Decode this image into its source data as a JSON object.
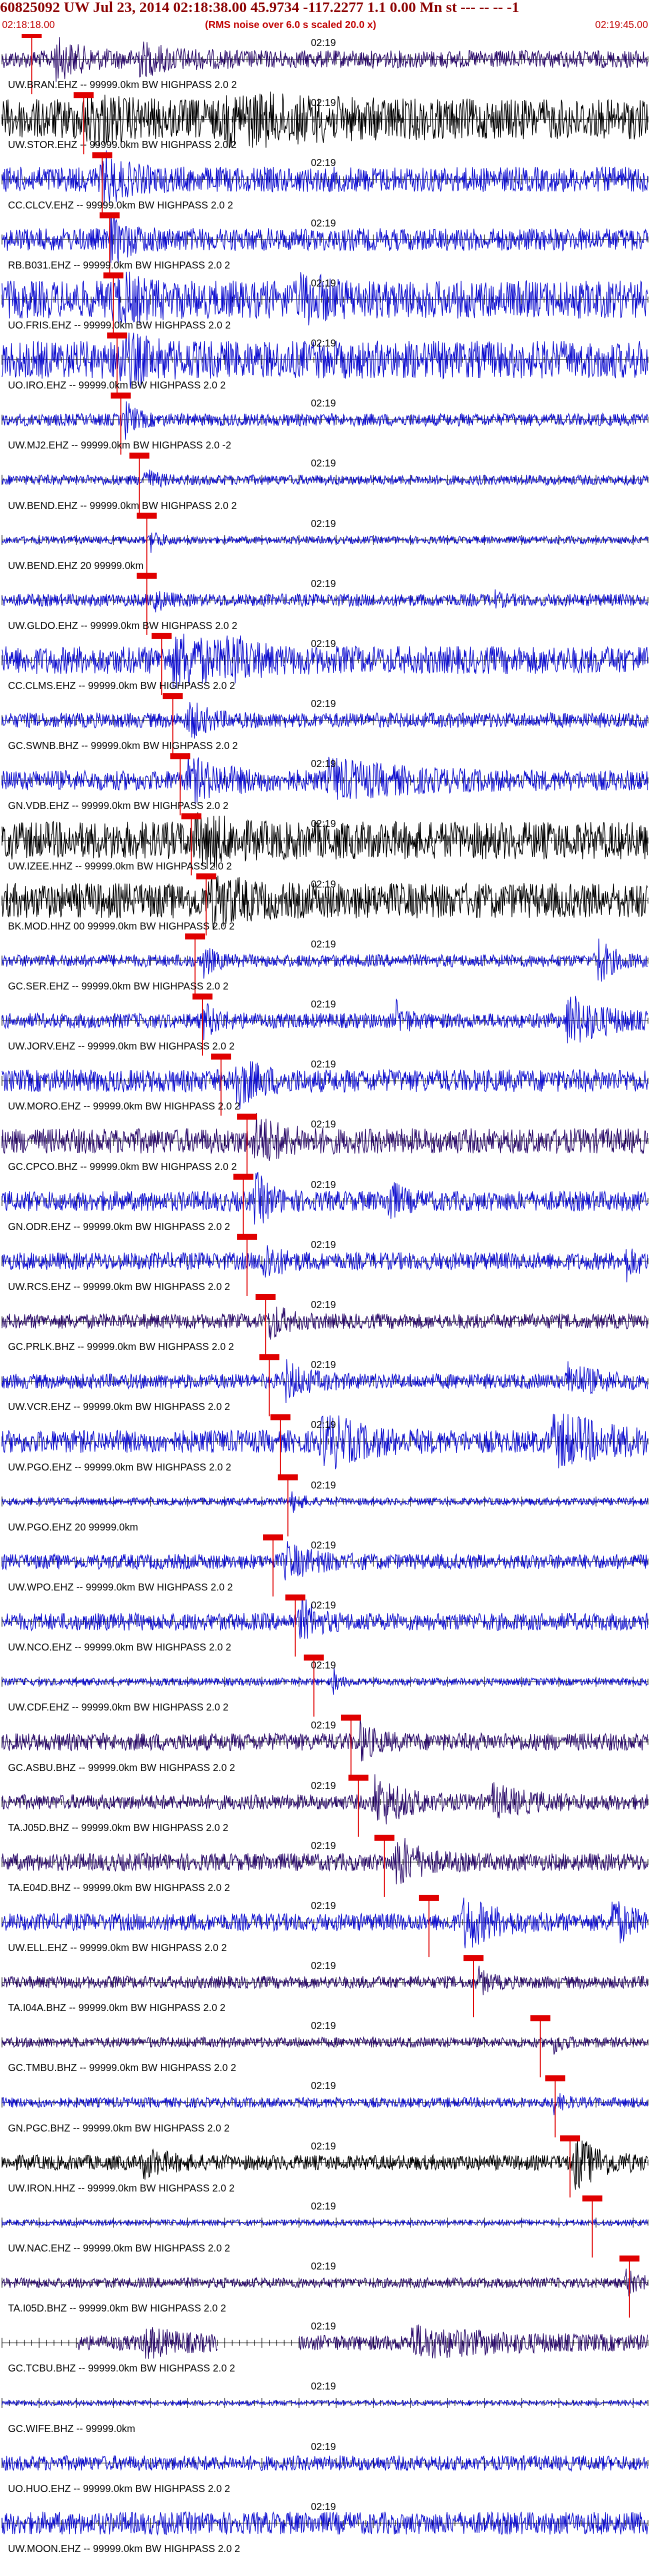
{
  "header": {
    "title": "60825092 UW Jul 23, 2014 02:18:38.00   45.9734 -117.2277  1.1 0.00 Mn st --- -- --  -1",
    "subtitle": "(RMS noise over 6.0 s scaled 20.0 x)",
    "start_time": "02:18:18.00",
    "end_time": "02:19:45.00"
  },
  "colors": {
    "blue_trace": "#1010d0",
    "black_trace": "#000000",
    "purple_trace": "#2a0a6a",
    "pick": "#e00000",
    "tick": "#000000",
    "background": "#ffffff"
  },
  "chart_data": {
    "type": "line",
    "title": "60825092 UW Jul 23, 2014 02:18:38.00   45.9734 -117.2277  1.1 0.00 Mn st --- -- --  -1",
    "subtitle": "(RMS noise over 6.0 s scaled 20.0 x)",
    "x_range": [
      "02:18:18.00",
      "02:19:45.00"
    ],
    "x_start_seconds": 0,
    "x_end_seconds": 87,
    "time_tick_label": "02:19",
    "time_tick_seconds": 42,
    "grid": false,
    "legend": "none",
    "traces": [
      {
        "label": "UW.BRAN.EHZ -- 99999.0km BW HIGHPASS 2.0 2",
        "color": "purple",
        "pick": 4.0,
        "noise": 0.35,
        "events": [
          [
            7,
            7,
            0.7
          ],
          [
            18,
            10,
            0.5
          ]
        ]
      },
      {
        "label": "UW.STOR.EHZ -- 99999.0km BW HIGHPASS 2.0 2",
        "color": "black",
        "pick": 11.0,
        "noise": 0.8,
        "events": [
          [
            11,
            6,
            1.0
          ],
          [
            30,
            20,
            0.6
          ]
        ]
      },
      {
        "label": "CC.CLCV.EHZ -- 99999.0km BW HIGHPASS 2.0 2",
        "color": "blue",
        "pick": 13.5,
        "noise": 0.5,
        "events": [
          [
            13.5,
            6,
            0.8
          ]
        ]
      },
      {
        "label": "RB.B031.EHZ -- 99999.0km BW HIGHPASS 2.0 2",
        "color": "blue",
        "pick": 14.5,
        "noise": 0.45,
        "events": [
          [
            14.5,
            5,
            0.8
          ]
        ]
      },
      {
        "label": "UO.FRIS.EHZ -- 99999.0km BW HIGHPASS 2.0 2",
        "color": "blue",
        "pick": 15.0,
        "noise": 0.75,
        "events": [
          [
            15,
            5,
            1.0
          ],
          [
            40,
            6,
            0.7
          ]
        ]
      },
      {
        "label": "UO.IRO.EHZ -- 99999.0km BW HIGHPASS 2.0 2",
        "color": "blue",
        "pick": 15.5,
        "noise": 0.75,
        "events": [
          [
            15.5,
            6,
            0.9
          ]
        ]
      },
      {
        "label": "UW.MJ2.EHZ -- 99999.0km BW HIGHPASS 2.0 -2",
        "color": "blue",
        "pick": 16.0,
        "noise": 0.25,
        "events": [
          [
            16.5,
            3,
            0.7
          ]
        ]
      },
      {
        "label": "UW.BEND.EHZ -- 99999.0km BW HIGHPASS 2.0 2",
        "color": "blue",
        "pick": 18.5,
        "noise": 0.2,
        "events": [
          [
            19,
            3,
            0.5
          ]
        ]
      },
      {
        "label": "UW.BEND.EHZ 20 99999.0km",
        "color": "blue",
        "pick": 19.5,
        "noise": 0.15,
        "events": [
          [
            20,
            3,
            0.4
          ]
        ]
      },
      {
        "label": "UW.GLDO.EHZ -- 99999.0km BW HIGHPASS 2.0 2",
        "color": "blue",
        "pick": 19.5,
        "noise": 0.25,
        "events": [
          [
            20,
            3,
            0.5
          ],
          [
            66,
            2,
            0.3
          ]
        ]
      },
      {
        "label": "CC.CLMS.EHZ -- 99999.0km BW HIGHPASS 2.0 2",
        "color": "blue",
        "pick": 21.5,
        "noise": 0.55,
        "events": [
          [
            23,
            10,
            1.0
          ],
          [
            30,
            5,
            0.8
          ]
        ]
      },
      {
        "label": "GC.SWNB.BHZ -- 99999.0km BW HIGHPASS 2.0 2",
        "color": "blue",
        "pick": 23.0,
        "noise": 0.3,
        "events": [
          [
            25,
            5,
            0.7
          ]
        ]
      },
      {
        "label": "GN.VDB.EHZ -- 99999.0km BW HIGHPASS 2.0 2",
        "color": "blue",
        "pick": 24.0,
        "noise": 0.4,
        "events": [
          [
            25,
            10,
            0.7
          ],
          [
            44,
            20,
            0.6
          ]
        ]
      },
      {
        "label": "UW.IZEE.HHZ -- 99999.0km BW HIGHPASS 2.0 2",
        "color": "black",
        "pick": 25.5,
        "noise": 0.75,
        "events": [
          [
            26,
            6,
            1.0
          ]
        ]
      },
      {
        "label": "BK.MOD.HHZ 00 99999.0km BW HIGHPASS 2.0 2",
        "color": "black",
        "pick": 27.5,
        "noise": 0.7,
        "events": [
          [
            28,
            6,
            1.0
          ]
        ]
      },
      {
        "label": "GC.SER.EHZ -- 99999.0km BW HIGHPASS 2.0 2",
        "color": "blue",
        "pick": 26.0,
        "noise": 0.25,
        "events": [
          [
            27,
            3,
            0.6
          ],
          [
            80,
            4,
            1.0
          ]
        ]
      },
      {
        "label": "UW.JORV.EHZ -- 99999.0km BW HIGHPASS 2.0 2",
        "color": "blue",
        "pick": 27.0,
        "noise": 0.3,
        "events": [
          [
            27,
            4,
            0.6
          ],
          [
            53,
            3,
            0.6
          ],
          [
            76,
            10,
            1.0
          ]
        ]
      },
      {
        "label": "UW.MORO.EHZ -- 99999.0km BW HIGHPASS 2.0 2",
        "color": "blue",
        "pick": 29.5,
        "noise": 0.45,
        "events": [
          [
            31,
            6,
            1.0
          ]
        ]
      },
      {
        "label": "GC.CPCO.BHZ -- 99999.0km BW HIGHPASS 2.0 2",
        "color": "purple",
        "pick": 33.0,
        "noise": 0.5,
        "events": [
          [
            34,
            6,
            0.9
          ]
        ]
      },
      {
        "label": "GN.ODR.EHZ -- 99999.0km BW HIGHPASS 2.0 2",
        "color": "blue",
        "pick": 32.5,
        "noise": 0.4,
        "events": [
          [
            34,
            4,
            1.0
          ],
          [
            52,
            3,
            0.8
          ]
        ]
      },
      {
        "label": "UW.RCS.EHZ -- 99999.0km BW HIGHPASS 2.0 2",
        "color": "blue",
        "pick": 33.0,
        "noise": 0.35,
        "events": [
          [
            35,
            4,
            0.8
          ],
          [
            84,
            3,
            0.6
          ]
        ]
      },
      {
        "label": "GC.PRLK.BHZ -- 99999.0km BW HIGHPASS 2.0 2",
        "color": "purple",
        "pick": 35.5,
        "noise": 0.3,
        "events": [
          [
            36,
            4,
            0.7
          ]
        ]
      },
      {
        "label": "UW.VCR.EHZ -- 99999.0km BW HIGHPASS 2.0 2",
        "color": "blue",
        "pick": 36.0,
        "noise": 0.3,
        "events": [
          [
            38,
            6,
            0.7
          ],
          [
            76,
            8,
            0.6
          ]
        ]
      },
      {
        "label": "UW.PGO.EHZ -- 99999.0km BW HIGHPASS 2.0 2",
        "color": "blue",
        "pick": 37.5,
        "noise": 0.45,
        "events": [
          [
            43,
            10,
            1.0
          ],
          [
            74,
            14,
            1.0
          ]
        ]
      },
      {
        "label": "UW.PGO.EHZ 20 99999.0km",
        "color": "blue",
        "pick": 38.5,
        "noise": 0.15,
        "events": [
          [
            39,
            3,
            0.4
          ]
        ]
      },
      {
        "label": "UW.WPO.EHZ -- 99999.0km BW HIGHPASS 2.0 2",
        "color": "blue",
        "pick": 36.5,
        "noise": 0.3,
        "events": [
          [
            38,
            8,
            0.6
          ]
        ]
      },
      {
        "label": "UW.NCO.EHZ -- 99999.0km BW HIGHPASS 2.0 2",
        "color": "blue",
        "pick": 39.5,
        "noise": 0.35,
        "events": [
          [
            40,
            4,
            0.9
          ]
        ]
      },
      {
        "label": "UW.CDF.EHZ -- 99999.0km BW HIGHPASS 2.0 2",
        "color": "blue",
        "pick": 42.0,
        "noise": 0.15,
        "events": [
          [
            44.5,
            1.5,
            0.6
          ]
        ]
      },
      {
        "label": "GC.ASBU.BHZ -- 99999.0km BW HIGHPASS 2.0 2",
        "color": "purple",
        "pick": 47.0,
        "noise": 0.35,
        "events": [
          [
            48,
            4,
            0.7
          ]
        ]
      },
      {
        "label": "TA.J05D.BHZ -- 99999.0km BW HIGHPASS 2.0 2",
        "color": "purple",
        "pick": 48.0,
        "noise": 0.3,
        "events": [
          [
            50,
            8,
            1.0
          ],
          [
            66,
            10,
            0.5
          ]
        ]
      },
      {
        "label": "TA.E04D.BHZ -- 99999.0km BW HIGHPASS 2.0 2",
        "color": "purple",
        "pick": 51.5,
        "noise": 0.35,
        "events": [
          [
            53,
            6,
            1.0
          ]
        ]
      },
      {
        "label": "UW.ELL.EHZ -- 99999.0km BW HIGHPASS 2.0 2",
        "color": "blue",
        "pick": 57.5,
        "noise": 0.35,
        "events": [
          [
            62,
            8,
            1.0
          ],
          [
            82,
            5,
            0.9
          ]
        ]
      },
      {
        "label": "TA.I04A.BHZ -- 99999.0km BW HIGHPASS 2.0 2",
        "color": "purple",
        "pick": 63.5,
        "noise": 0.25,
        "events": [
          [
            64,
            3,
            0.5
          ]
        ]
      },
      {
        "label": "GC.TMBU.BHZ -- 99999.0km BW HIGHPASS 2.0 2",
        "color": "purple",
        "pick": 72.5,
        "noise": 0.2,
        "events": [
          [
            74,
            3,
            0.4
          ]
        ]
      },
      {
        "label": "GN.PGC.BHZ -- 99999.0km BW HIGHPASS 2.0 2",
        "color": "blue",
        "pick": 74.5,
        "noise": 0.2,
        "events": [
          [
            74,
            3,
            0.4
          ]
        ]
      },
      {
        "label": "UW.IRON.HHZ -- 99999.0km BW HIGHPASS 2.0 2",
        "color": "black",
        "pick": 76.5,
        "noise": 0.3,
        "events": [
          [
            19,
            6,
            0.5
          ],
          [
            77,
            7,
            1.0
          ]
        ]
      },
      {
        "label": "UW.NAC.EHZ -- 99999.0km BW HIGHPASS 2.0 2",
        "color": "blue",
        "pick": 79.5,
        "noise": 0.12,
        "events": []
      },
      {
        "label": "TA.I05D.BHZ -- 99999.0km BW HIGHPASS 2.0 2",
        "color": "purple",
        "pick": 84.5,
        "noise": 0.2,
        "events": [
          [
            84,
            4,
            0.5
          ]
        ]
      },
      {
        "label": "GC.TCBU.BHZ -- 99999.0km BW HIGHPASS 2.0 2",
        "color": "purple",
        "pick": null,
        "noise": 0.3,
        "gaps": [
          [
            0,
            10
          ],
          [
            29,
            40
          ]
        ],
        "events": [
          [
            19,
            10,
            0.5
          ],
          [
            55,
            25,
            0.5
          ]
        ]
      },
      {
        "label": "GC.WIFE.BHZ -- 99999.0km",
        "color": "blue",
        "pick": null,
        "noise": 0.1,
        "events": []
      },
      {
        "label": "UO.HUO.EHZ -- 99999.0km BW HIGHPASS 2.0 2",
        "color": "blue",
        "pick": null,
        "noise": 0.3,
        "events": []
      },
      {
        "label": "UW.MOON.EHZ -- 99999.0km BW HIGHPASS 2.0 2",
        "color": "blue",
        "pick": null,
        "noise": 0.45,
        "events": []
      }
    ]
  }
}
